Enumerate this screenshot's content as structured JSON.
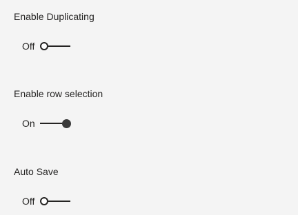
{
  "settings": [
    {
      "label": "Enable Duplicating",
      "state_label": "Off",
      "state": "off"
    },
    {
      "label": "Enable row selection",
      "state_label": "On",
      "state": "on"
    },
    {
      "label": "Auto Save",
      "state_label": "Off",
      "state": "off"
    }
  ],
  "colors": {
    "background": "#f4f4f4",
    "text": "#252423",
    "toggle_on_knob": "#3a3a3a"
  }
}
